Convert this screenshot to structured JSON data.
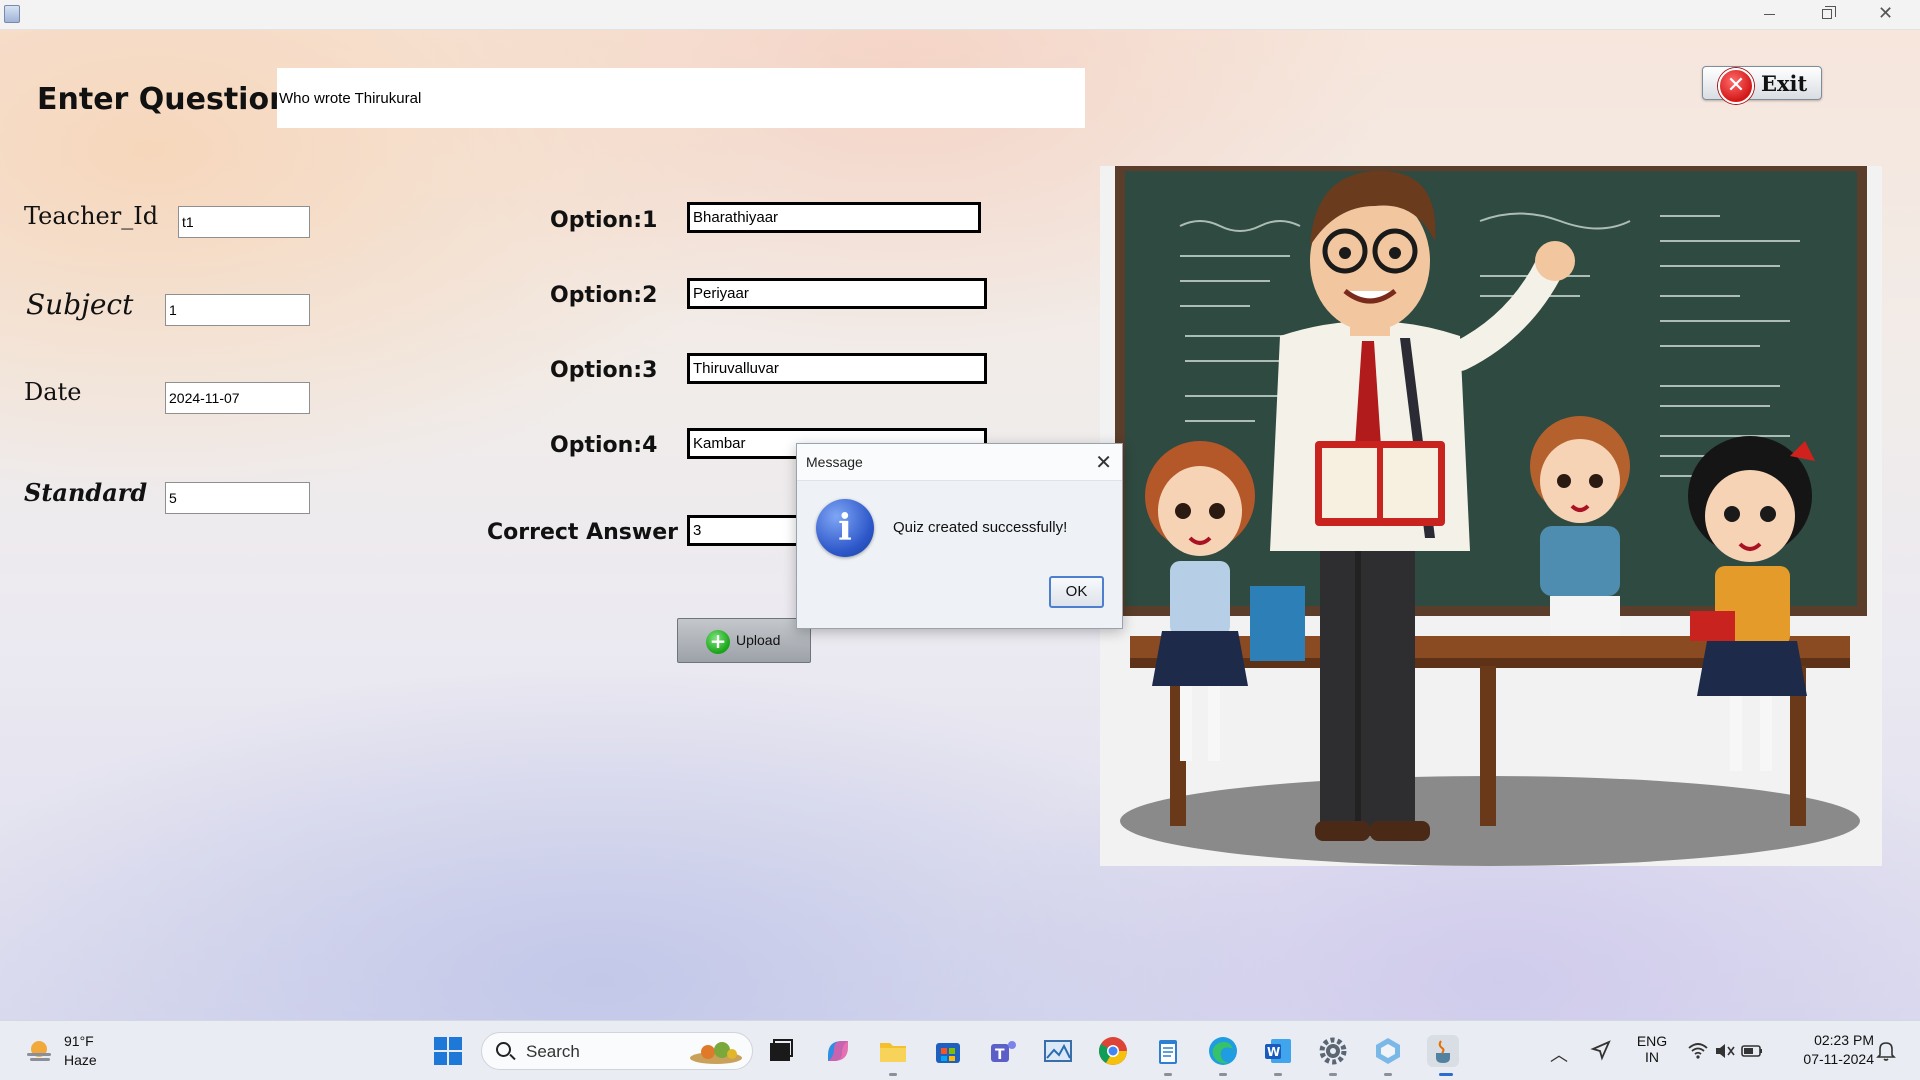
{
  "window": {
    "title_bar_controls": [
      "minimize-icon",
      "restore-icon",
      "close-icon"
    ]
  },
  "form": {
    "enter_question_label": "Enter Question",
    "question_value": "Who wrote Thirukural",
    "teacher_id_label": "Teacher_Id",
    "teacher_id_value": "t1",
    "subject_label": "Subject",
    "subject_value": "1",
    "date_label": "Date",
    "date_value": "2024-11-07",
    "standard_label": "Standard",
    "standard_value": "5",
    "options": [
      {
        "label": "Option:1",
        "value": "Bharathiyaar"
      },
      {
        "label": "Option:2",
        "value": "Periyaar"
      },
      {
        "label": "Option:3",
        "value": "Thiruvalluvar"
      },
      {
        "label": "Option:4",
        "value": "Kambar"
      }
    ],
    "correct_answer_label": "Correct Answer",
    "correct_answer_value": "3",
    "upload_label": "Upload",
    "exit_label": "Exit"
  },
  "dialog": {
    "title": "Message",
    "message": "Quiz created successfully!",
    "ok_label": "OK",
    "icon": "info-icon"
  },
  "taskbar": {
    "weather_temp": "91°F",
    "weather_desc": "Haze",
    "search_placeholder": "Search",
    "language_top": "ENG",
    "language_bottom": "IN",
    "time": "02:23 PM",
    "date": "07-11-2024"
  },
  "colors": {
    "chalkboard": "#2f4a40",
    "accent_blue": "#4d7fcf",
    "exit_red": "#d31818",
    "upload_green": "#17a317"
  }
}
